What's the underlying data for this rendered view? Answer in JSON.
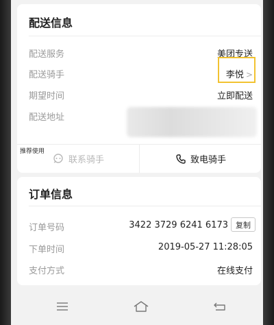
{
  "delivery": {
    "title": "配送信息",
    "rows": [
      {
        "label": "配送服务",
        "value": "美团专送"
      },
      {
        "label": "配送骑手",
        "value": "李悦"
      },
      {
        "label": "期望时间",
        "value": "立即配送"
      },
      {
        "label": "配送地址",
        "value": ""
      }
    ],
    "recommend_tag": "推荐使用",
    "contact_rider": "联系骑手",
    "call_rider": "致电骑手"
  },
  "order": {
    "title": "订单信息",
    "rows": [
      {
        "label": "订单号码",
        "value": "3422 3729 6241 6173"
      },
      {
        "label": "下单时间",
        "value": "2019-05-27 11:28:05"
      },
      {
        "label": "支付方式",
        "value": "在线支付"
      }
    ],
    "copy_label": "复制"
  },
  "navbar": {
    "icons": [
      "menu-icon",
      "home-icon",
      "back-icon"
    ]
  }
}
